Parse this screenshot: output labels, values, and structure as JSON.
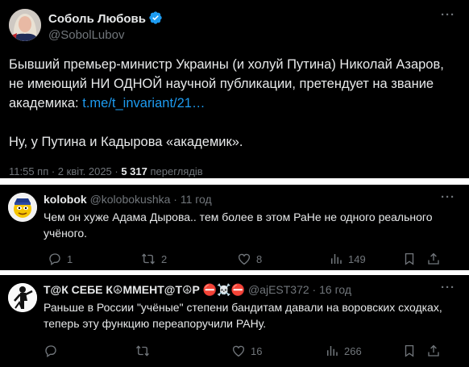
{
  "main_post": {
    "author_name": "Соболь Любовь",
    "author_handle": "@SobolLubov",
    "text_line1": "Бывший премьер-министр Украины (и холуй Путина) Николай Азаров,",
    "text_line2": "не имеющий НИ ОДНОЙ научной публикации, претендует на звание",
    "text_line3_prefix": "академика: ",
    "text_link": "t.me/t_invariant/21…",
    "text_line4": "Ну, у Путина и Кадырова «академик».",
    "time": "11:55 пп · 2 квіт. 2025 · ",
    "views_count": "5 317",
    "views_label": "переглядів"
  },
  "replies": [
    {
      "author_name": "kolobok",
      "author_handle": "@kolobokushka · 11 год",
      "text_line1": "Чем он хуже Адама Дырова.. тем более в этом РаНе не одного реального",
      "text_line2": "учёного.",
      "replies_count": "1",
      "reposts_count": "2",
      "likes_count": "8",
      "views_count": "149"
    },
    {
      "author_name": "Т@К СЕБЕ К☮ММЕНТ@Т☮Р ⛔☠️⛔",
      "author_handle": "@ajEST372 · 16 год",
      "text_line1": "Раньше в России \"учёные\" степени бандитам давали на воровских сходках,",
      "text_line2": "теперь эту функцию переапоручили РАНу.",
      "replies_count": "",
      "reposts_count": "",
      "likes_count": "16",
      "views_count": "266"
    }
  ],
  "colors": {
    "background": "#000000",
    "text": "#e7e9ea",
    "muted": "#71767b",
    "link": "#1d9bf0",
    "verified": "#1d9bf0",
    "separator": "#ffffff"
  },
  "icons": [
    "verified-badge-icon",
    "more-icon",
    "reply-icon",
    "repost-icon",
    "like-icon",
    "views-icon",
    "bookmark-icon",
    "share-icon"
  ]
}
